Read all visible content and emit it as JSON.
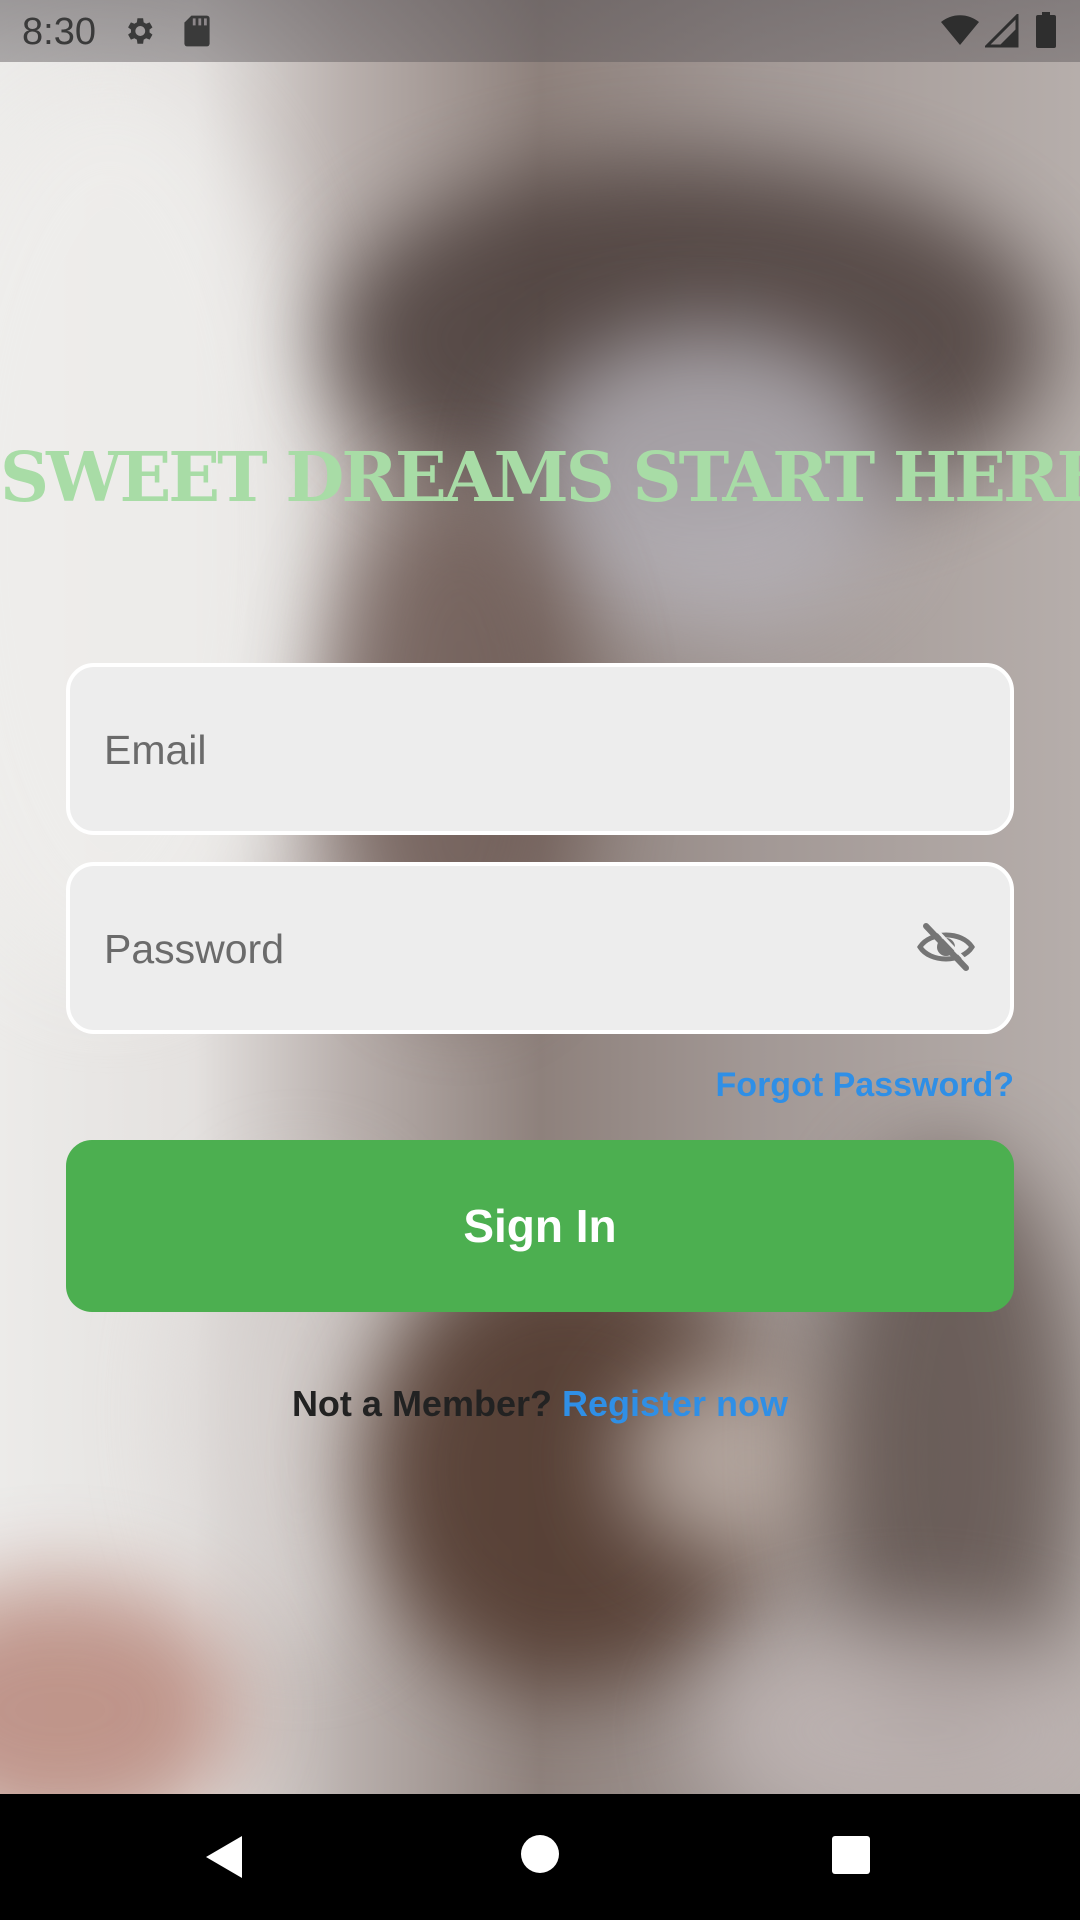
{
  "status_bar": {
    "time": "8:30",
    "icons": [
      "gear-icon",
      "sd-card-icon",
      "wifi-icon",
      "signal-icon",
      "battery-icon"
    ]
  },
  "title": "SWEET DREAMS START HERE",
  "email_field": {
    "placeholder": "Email"
  },
  "password_field": {
    "placeholder": "Password",
    "visibility_icon": "eye-off-icon"
  },
  "forgot_password": "Forgot Password?",
  "sign_in_button": "Sign In",
  "register": {
    "prompt": "Not a Member?",
    "link": "Register now"
  },
  "navigation": {
    "icons": [
      "back-icon",
      "home-icon",
      "recents-icon"
    ]
  },
  "colors": {
    "title": "#a8dca6",
    "accent_green": "#4caf50",
    "link_blue": "#2f8fe6"
  }
}
